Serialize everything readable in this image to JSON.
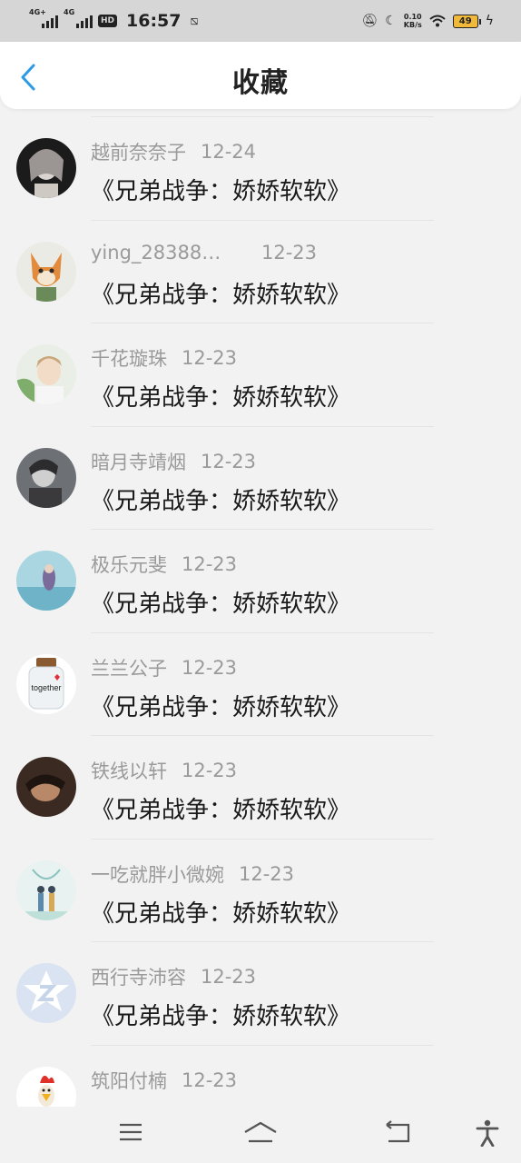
{
  "status_bar": {
    "net1": "4G+",
    "net2": "4G",
    "hd": "HD",
    "time": "16:57",
    "speed_top": "0.10",
    "speed_unit": "KB/s",
    "battery": "49"
  },
  "header": {
    "title": "收藏"
  },
  "favorites": [
    {
      "name": "越前奈奈子",
      "date": "12-24",
      "book": "《兄弟战争：娇娇软软》"
    },
    {
      "name": "ying_28388…",
      "date": "12-23",
      "book": "《兄弟战争：娇娇软软》"
    },
    {
      "name": "千花璇珠",
      "date": "12-23",
      "book": "《兄弟战争：娇娇软软》"
    },
    {
      "name": "暗月寺靖烟",
      "date": "12-23",
      "book": "《兄弟战争：娇娇软软》"
    },
    {
      "name": "极乐元斐",
      "date": "12-23",
      "book": "《兄弟战争：娇娇软软》"
    },
    {
      "name": "兰兰公子",
      "date": "12-23",
      "book": "《兄弟战争：娇娇软软》"
    },
    {
      "name": "铁线以轩",
      "date": "12-23",
      "book": "《兄弟战争：娇娇软软》"
    },
    {
      "name": "一吃就胖小微婉",
      "date": "12-23",
      "book": "《兄弟战争：娇娇软软》"
    },
    {
      "name": "西行寺沛容",
      "date": "12-23",
      "book": "《兄弟战争：娇娇软软》"
    },
    {
      "name": "筑阳付楠",
      "date": "12-23",
      "book": ""
    }
  ],
  "colors": {
    "accent": "#2b9be8",
    "muted": "#9a9a9a"
  }
}
